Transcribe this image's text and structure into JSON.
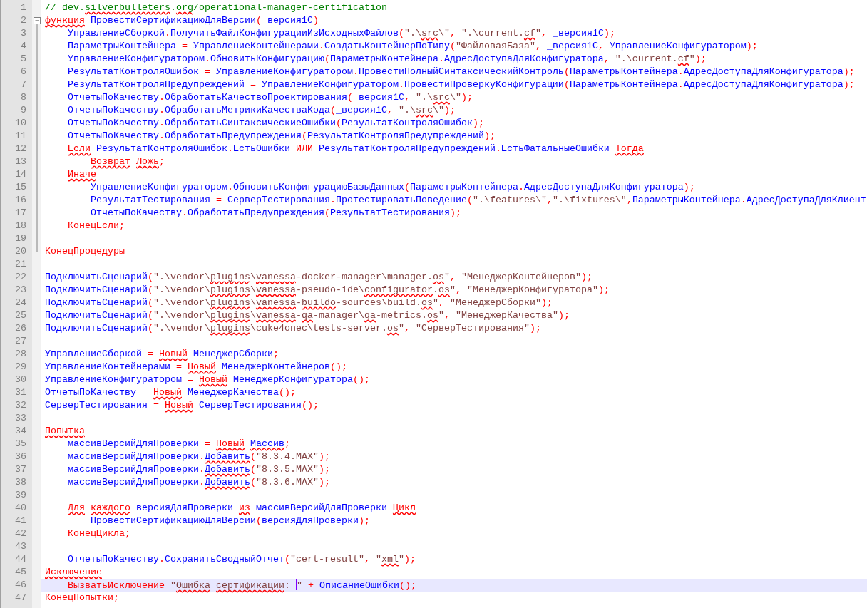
{
  "lines": [
    {
      "number": "1",
      "kind": "plain",
      "segments": [
        {
          "kind": "c",
          "text": "// dev."
        },
        {
          "kind": "c",
          "text": "silverbulleters",
          "spell": true
        },
        {
          "kind": "c",
          "text": "."
        },
        {
          "kind": "c",
          "text": "org",
          "spell": true
        },
        {
          "kind": "c",
          "text": "/operational-manager-certification"
        }
      ]
    },
    {
      "number": "2",
      "kind": "fold-start",
      "segments": [
        {
          "kind": "kw",
          "text": "функция",
          "spell": true
        },
        {
          "kind": "id",
          "text": " ПровестиСертификациюДляВерсии"
        },
        {
          "kind": "op",
          "text": "("
        },
        {
          "kind": "id",
          "text": "_версия1С"
        },
        {
          "kind": "op",
          "text": ")"
        }
      ]
    },
    {
      "number": "3",
      "kind": "fold-body",
      "segments": [
        {
          "kind": "indent"
        },
        {
          "kind": "id",
          "text": "УправлениеСборкой"
        },
        {
          "kind": "op",
          "text": "."
        },
        {
          "kind": "id",
          "text": "ПолучитьФайлКонфигурацииИзИсходныхФайлов"
        },
        {
          "kind": "op",
          "text": "("
        },
        {
          "kind": "s",
          "text": "\".\\"
        },
        {
          "kind": "s",
          "text": "src",
          "spell": true
        },
        {
          "kind": "s",
          "text": "\\\""
        },
        {
          "kind": "op",
          "text": ", "
        },
        {
          "kind": "s",
          "text": "\".\\current."
        },
        {
          "kind": "s",
          "text": "cf",
          "spell": true
        },
        {
          "kind": "s",
          "text": "\""
        },
        {
          "kind": "op",
          "text": ", "
        },
        {
          "kind": "id",
          "text": "_версия1С"
        },
        {
          "kind": "op",
          "text": ");"
        }
      ]
    },
    {
      "number": "4",
      "kind": "fold-body",
      "segments": [
        {
          "kind": "indent"
        },
        {
          "kind": "id",
          "text": "ПараметрыКонтейнера"
        },
        {
          "kind": "op",
          "text": " = "
        },
        {
          "kind": "id",
          "text": "УправлениеКонтейнерами"
        },
        {
          "kind": "op",
          "text": "."
        },
        {
          "kind": "id",
          "text": "СоздатьКонтейнерПоТипу"
        },
        {
          "kind": "op",
          "text": "("
        },
        {
          "kind": "s",
          "text": "\"ФайловаяБаза\""
        },
        {
          "kind": "op",
          "text": ", "
        },
        {
          "kind": "id",
          "text": "_версия1С"
        },
        {
          "kind": "op",
          "text": ", "
        },
        {
          "kind": "id",
          "text": "УправлениеКонфигуратором"
        },
        {
          "kind": "op",
          "text": ");"
        }
      ]
    },
    {
      "number": "5",
      "kind": "fold-body",
      "segments": [
        {
          "kind": "indent"
        },
        {
          "kind": "id",
          "text": "УправлениеКонфигуратором"
        },
        {
          "kind": "op",
          "text": "."
        },
        {
          "kind": "id",
          "text": "ОбновитьКонфигурацию"
        },
        {
          "kind": "op",
          "text": "("
        },
        {
          "kind": "id",
          "text": "ПараметрыКонтейнера"
        },
        {
          "kind": "op",
          "text": "."
        },
        {
          "kind": "id",
          "text": "АдресДоступаДляКонфигуратора"
        },
        {
          "kind": "op",
          "text": ", "
        },
        {
          "kind": "s",
          "text": "\".\\current."
        },
        {
          "kind": "s",
          "text": "cf",
          "spell": true
        },
        {
          "kind": "s",
          "text": "\""
        },
        {
          "kind": "op",
          "text": ");"
        }
      ]
    },
    {
      "number": "6",
      "kind": "fold-body",
      "segments": [
        {
          "kind": "indent"
        },
        {
          "kind": "id",
          "text": "РезультатКонтроляОшибок"
        },
        {
          "kind": "op",
          "text": " = "
        },
        {
          "kind": "id",
          "text": "УправлениеКонфигуратором"
        },
        {
          "kind": "op",
          "text": "."
        },
        {
          "kind": "id",
          "text": "ПровестиПолныйСинтаксическийКонтроль"
        },
        {
          "kind": "op",
          "text": "("
        },
        {
          "kind": "id",
          "text": "ПараметрыКонтейнера"
        },
        {
          "kind": "op",
          "text": "."
        },
        {
          "kind": "id",
          "text": "АдресДоступаДляКонфигуратора"
        },
        {
          "kind": "op",
          "text": ");"
        }
      ]
    },
    {
      "number": "7",
      "kind": "fold-body",
      "segments": [
        {
          "kind": "indent"
        },
        {
          "kind": "id",
          "text": "РезультатКонтроляПредупреждений"
        },
        {
          "kind": "op",
          "text": " = "
        },
        {
          "kind": "id",
          "text": "УправлениеКонфигуратором"
        },
        {
          "kind": "op",
          "text": "."
        },
        {
          "kind": "id",
          "text": "ПровестиПроверкуКонфигурации"
        },
        {
          "kind": "op",
          "text": "("
        },
        {
          "kind": "id",
          "text": "ПараметрыКонтейнера"
        },
        {
          "kind": "op",
          "text": "."
        },
        {
          "kind": "id",
          "text": "АдресДоступаДляКонфигуратора"
        },
        {
          "kind": "op",
          "text": ");"
        }
      ]
    },
    {
      "number": "8",
      "kind": "fold-body",
      "segments": [
        {
          "kind": "indent"
        },
        {
          "kind": "id",
          "text": "ОтчетыПоКачеству"
        },
        {
          "kind": "op",
          "text": "."
        },
        {
          "kind": "id",
          "text": "ОбработатьКачествоПроектирования"
        },
        {
          "kind": "op",
          "text": "("
        },
        {
          "kind": "id",
          "text": "_версия1С"
        },
        {
          "kind": "op",
          "text": ", "
        },
        {
          "kind": "s",
          "text": "\".\\"
        },
        {
          "kind": "s",
          "text": "src",
          "spell": true
        },
        {
          "kind": "s",
          "text": "\\\""
        },
        {
          "kind": "op",
          "text": ");"
        }
      ]
    },
    {
      "number": "9",
      "kind": "fold-body",
      "segments": [
        {
          "kind": "indent"
        },
        {
          "kind": "id",
          "text": "ОтчетыПоКачеству"
        },
        {
          "kind": "op",
          "text": "."
        },
        {
          "kind": "id",
          "text": "ОбработатьМетрикиКачестваКода"
        },
        {
          "kind": "op",
          "text": "("
        },
        {
          "kind": "id",
          "text": "_версия1С"
        },
        {
          "kind": "op",
          "text": ", "
        },
        {
          "kind": "s",
          "text": "\".\\"
        },
        {
          "kind": "s",
          "text": "src",
          "spell": true
        },
        {
          "kind": "s",
          "text": "\\\""
        },
        {
          "kind": "op",
          "text": ");"
        }
      ]
    },
    {
      "number": "10",
      "kind": "fold-body",
      "segments": [
        {
          "kind": "indent"
        },
        {
          "kind": "id",
          "text": "ОтчетыПоКачеству"
        },
        {
          "kind": "op",
          "text": "."
        },
        {
          "kind": "id",
          "text": "ОбработатьСинтаксическиеОшибки"
        },
        {
          "kind": "op",
          "text": "("
        },
        {
          "kind": "id",
          "text": "РезультатКонтроляОшибок"
        },
        {
          "kind": "op",
          "text": ");"
        }
      ]
    },
    {
      "number": "11",
      "kind": "fold-body",
      "segments": [
        {
          "kind": "indent"
        },
        {
          "kind": "id",
          "text": "ОтчетыПоКачеству"
        },
        {
          "kind": "op",
          "text": "."
        },
        {
          "kind": "id",
          "text": "ОбработатьПредупреждения"
        },
        {
          "kind": "op",
          "text": "("
        },
        {
          "kind": "id",
          "text": "РезультатКонтроляПредупреждений"
        },
        {
          "kind": "op",
          "text": ");"
        }
      ]
    },
    {
      "number": "12",
      "kind": "fold-body",
      "segments": [
        {
          "kind": "indent"
        },
        {
          "kind": "kw",
          "text": "Если",
          "spell": true
        },
        {
          "kind": "id",
          "text": " РезультатКонтроляОшибок"
        },
        {
          "kind": "op",
          "text": "."
        },
        {
          "kind": "id",
          "text": "ЕстьОшибки "
        },
        {
          "kind": "kw",
          "text": "ИЛИ"
        },
        {
          "kind": "id",
          "text": " РезультатКонтроляПредупреждений"
        },
        {
          "kind": "op",
          "text": "."
        },
        {
          "kind": "id",
          "text": "ЕстьФатальныеОшибки "
        },
        {
          "kind": "kw",
          "text": "Тогда",
          "spell": true
        }
      ]
    },
    {
      "number": "13",
      "kind": "fold-body",
      "segments": [
        {
          "kind": "indent"
        },
        {
          "kind": "indent"
        },
        {
          "kind": "kw",
          "text": "Возврат",
          "spell": true
        },
        {
          "kind": "gap"
        },
        {
          "kind": "kw",
          "text": "Ложь",
          "spell": true
        },
        {
          "kind": "op",
          "text": ";"
        }
      ]
    },
    {
      "number": "14",
      "kind": "fold-body",
      "segments": [
        {
          "kind": "indent"
        },
        {
          "kind": "kw",
          "text": "Иначе",
          "spell": true
        }
      ]
    },
    {
      "number": "15",
      "kind": "fold-body",
      "segments": [
        {
          "kind": "indent"
        },
        {
          "kind": "indent"
        },
        {
          "kind": "id",
          "text": "УправлениеКонфигуратором"
        },
        {
          "kind": "op",
          "text": "."
        },
        {
          "kind": "id",
          "text": "ОбновитьКонфигурациюБазыДанных"
        },
        {
          "kind": "op",
          "text": "("
        },
        {
          "kind": "id",
          "text": "ПараметрыКонтейнера"
        },
        {
          "kind": "op",
          "text": "."
        },
        {
          "kind": "id",
          "text": "АдресДоступаДляКонфигуратора"
        },
        {
          "kind": "op",
          "text": ");"
        }
      ]
    },
    {
      "number": "16",
      "kind": "fold-body",
      "segments": [
        {
          "kind": "indent"
        },
        {
          "kind": "indent"
        },
        {
          "kind": "id",
          "text": "РезультатТестирования"
        },
        {
          "kind": "op",
          "text": " = "
        },
        {
          "kind": "id",
          "text": "СерверТестирования"
        },
        {
          "kind": "op",
          "text": "."
        },
        {
          "kind": "id",
          "text": "ПротестироватьПоведение"
        },
        {
          "kind": "op",
          "text": "("
        },
        {
          "kind": "s",
          "text": "\".\\features\\\""
        },
        {
          "kind": "op",
          "text": ","
        },
        {
          "kind": "s",
          "text": "\".\\fixtures\\\""
        },
        {
          "kind": "op",
          "text": ","
        },
        {
          "kind": "id",
          "text": "ПараметрыКонтейнера"
        },
        {
          "kind": "op",
          "text": "."
        },
        {
          "kind": "id",
          "text": "АдресДоступаДляКлиент"
        }
      ]
    },
    {
      "number": "17",
      "kind": "fold-body",
      "segments": [
        {
          "kind": "indent"
        },
        {
          "kind": "indent"
        },
        {
          "kind": "id",
          "text": "ОтчетыПоКачеству"
        },
        {
          "kind": "op",
          "text": "."
        },
        {
          "kind": "id",
          "text": "ОбработатьПредупреждения"
        },
        {
          "kind": "op",
          "text": "("
        },
        {
          "kind": "id",
          "text": "РезультатТестирования"
        },
        {
          "kind": "op",
          "text": ");"
        }
      ]
    },
    {
      "number": "18",
      "kind": "fold-body",
      "segments": [
        {
          "kind": "indent"
        },
        {
          "kind": "kw",
          "text": "КонецЕсли"
        },
        {
          "kind": "op",
          "text": ";"
        }
      ]
    },
    {
      "number": "19",
      "kind": "fold-body"
    },
    {
      "number": "20",
      "kind": "fold-end",
      "segments": [
        {
          "kind": "kw",
          "text": "КонецПроцедуры"
        }
      ]
    },
    {
      "number": "21",
      "kind": "plain"
    },
    {
      "number": "22",
      "kind": "plain",
      "segments": [
        {
          "kind": "id",
          "text": "ПодключитьСценарий"
        },
        {
          "kind": "op",
          "text": "("
        },
        {
          "kind": "s",
          "text": "\".\\vendor\\"
        },
        {
          "kind": "s",
          "text": "plugins",
          "spell": true
        },
        {
          "kind": "s",
          "text": "\\"
        },
        {
          "kind": "s",
          "text": "vanessa",
          "spell": true
        },
        {
          "kind": "s",
          "text": "-docker-manager\\manager."
        },
        {
          "kind": "s",
          "text": "os",
          "spell": true
        },
        {
          "kind": "s",
          "text": "\""
        },
        {
          "kind": "op",
          "text": ", "
        },
        {
          "kind": "s",
          "text": "\"МенеджерКонтейнеров\""
        },
        {
          "kind": "op",
          "text": ");"
        }
      ]
    },
    {
      "number": "23",
      "kind": "plain",
      "segments": [
        {
          "kind": "id",
          "text": "ПодключитьСценарий"
        },
        {
          "kind": "op",
          "text": "("
        },
        {
          "kind": "s",
          "text": "\".\\vendor\\"
        },
        {
          "kind": "s",
          "text": "plugins",
          "spell": true
        },
        {
          "kind": "s",
          "text": "\\"
        },
        {
          "kind": "s",
          "text": "vanessa",
          "spell": true
        },
        {
          "kind": "s",
          "text": "-pseudo-ide\\"
        },
        {
          "kind": "s",
          "text": "configurator",
          "spell": true
        },
        {
          "kind": "s",
          "text": "."
        },
        {
          "kind": "s",
          "text": "os",
          "spell": true
        },
        {
          "kind": "s",
          "text": "\""
        },
        {
          "kind": "op",
          "text": ", "
        },
        {
          "kind": "s",
          "text": "\"МенеджерКонфигуратора\""
        },
        {
          "kind": "op",
          "text": ");"
        }
      ]
    },
    {
      "number": "24",
      "kind": "plain",
      "segments": [
        {
          "kind": "id",
          "text": "ПодключитьСценарий"
        },
        {
          "kind": "op",
          "text": "("
        },
        {
          "kind": "s",
          "text": "\".\\vendor\\"
        },
        {
          "kind": "s",
          "text": "plugins",
          "spell": true
        },
        {
          "kind": "s",
          "text": "\\"
        },
        {
          "kind": "s",
          "text": "vanessa",
          "spell": true
        },
        {
          "kind": "s",
          "text": "-"
        },
        {
          "kind": "s",
          "text": "buildo",
          "spell": true
        },
        {
          "kind": "s",
          "text": "-sources\\build."
        },
        {
          "kind": "s",
          "text": "os",
          "spell": true
        },
        {
          "kind": "s",
          "text": "\""
        },
        {
          "kind": "op",
          "text": ", "
        },
        {
          "kind": "s",
          "text": "\"МенеджерСборки\""
        },
        {
          "kind": "op",
          "text": ");"
        }
      ]
    },
    {
      "number": "25",
      "kind": "plain",
      "segments": [
        {
          "kind": "id",
          "text": "ПодключитьСценарий"
        },
        {
          "kind": "op",
          "text": "("
        },
        {
          "kind": "s",
          "text": "\".\\vendor\\"
        },
        {
          "kind": "s",
          "text": "plugins",
          "spell": true
        },
        {
          "kind": "s",
          "text": "\\"
        },
        {
          "kind": "s",
          "text": "vanessa",
          "spell": true
        },
        {
          "kind": "s",
          "text": "-"
        },
        {
          "kind": "s",
          "text": "qa",
          "spell": true
        },
        {
          "kind": "s",
          "text": "-manager\\"
        },
        {
          "kind": "s",
          "text": "qa",
          "spell": true
        },
        {
          "kind": "s",
          "text": "-metrics."
        },
        {
          "kind": "s",
          "text": "os",
          "spell": true
        },
        {
          "kind": "s",
          "text": "\""
        },
        {
          "kind": "op",
          "text": ", "
        },
        {
          "kind": "s",
          "text": "\"МенеджерКачества\""
        },
        {
          "kind": "op",
          "text": ");"
        }
      ]
    },
    {
      "number": "26",
      "kind": "plain",
      "segments": [
        {
          "kind": "id",
          "text": "ПодключитьСценарий"
        },
        {
          "kind": "op",
          "text": "("
        },
        {
          "kind": "s",
          "text": "\".\\vendor\\"
        },
        {
          "kind": "s",
          "text": "plugins",
          "spell": true
        },
        {
          "kind": "s",
          "text": "\\cuke4onec\\tests-server."
        },
        {
          "kind": "s",
          "text": "os",
          "spell": true
        },
        {
          "kind": "s",
          "text": "\""
        },
        {
          "kind": "op",
          "text": ", "
        },
        {
          "kind": "s",
          "text": "\"СерверТестирования\""
        },
        {
          "kind": "op",
          "text": ");"
        }
      ]
    },
    {
      "number": "27",
      "kind": "plain"
    },
    {
      "number": "28",
      "kind": "plain",
      "segments": [
        {
          "kind": "id",
          "text": "УправлениеСборкой"
        },
        {
          "kind": "op",
          "text": " = "
        },
        {
          "kind": "kw",
          "text": "Новый",
          "spell": true
        },
        {
          "kind": "id",
          "text": " МенеджерСборки"
        },
        {
          "kind": "op",
          "text": ";"
        }
      ]
    },
    {
      "number": "29",
      "kind": "plain",
      "segments": [
        {
          "kind": "id",
          "text": "УправлениеКонтейнерами"
        },
        {
          "kind": "op",
          "text": " = "
        },
        {
          "kind": "kw",
          "text": "Новый",
          "spell": true
        },
        {
          "kind": "id",
          "text": " МенеджерКонтейнеров"
        },
        {
          "kind": "op",
          "text": "();"
        }
      ]
    },
    {
      "number": "30",
      "kind": "plain",
      "segments": [
        {
          "kind": "id",
          "text": "УправлениеКонфигуратором"
        },
        {
          "kind": "op",
          "text": " = "
        },
        {
          "kind": "kw",
          "text": "Новый",
          "spell": true
        },
        {
          "kind": "id",
          "text": " МенеджерКонфигуратора"
        },
        {
          "kind": "op",
          "text": "();"
        }
      ]
    },
    {
      "number": "31",
      "kind": "plain",
      "segments": [
        {
          "kind": "id",
          "text": "ОтчетыПоКачеству"
        },
        {
          "kind": "op",
          "text": " = "
        },
        {
          "kind": "kw",
          "text": "Новый",
          "spell": true
        },
        {
          "kind": "id",
          "text": " МенеджерКачества"
        },
        {
          "kind": "op",
          "text": "();"
        }
      ]
    },
    {
      "number": "32",
      "kind": "plain",
      "segments": [
        {
          "kind": "id",
          "text": "СерверТестирования"
        },
        {
          "kind": "op",
          "text": " = "
        },
        {
          "kind": "kw",
          "text": "Новый",
          "spell": true
        },
        {
          "kind": "id",
          "text": " СерверТестирования"
        },
        {
          "kind": "op",
          "text": "();"
        }
      ]
    },
    {
      "number": "33",
      "kind": "plain"
    },
    {
      "number": "34",
      "kind": "plain",
      "segments": [
        {
          "kind": "kw",
          "text": "Попытка",
          "spell": true
        }
      ]
    },
    {
      "number": "35",
      "kind": "plain",
      "segments": [
        {
          "kind": "indent"
        },
        {
          "kind": "id",
          "text": "массивВерсийДляПроверки"
        },
        {
          "kind": "op",
          "text": " = "
        },
        {
          "kind": "kw",
          "text": "Новый",
          "spell": true
        },
        {
          "kind": "gap"
        },
        {
          "kind": "id",
          "text": "Массив",
          "spell": true
        },
        {
          "kind": "op",
          "text": ";"
        }
      ]
    },
    {
      "number": "36",
      "kind": "plain",
      "segments": [
        {
          "kind": "indent"
        },
        {
          "kind": "id",
          "text": "массивВерсийДляПроверки"
        },
        {
          "kind": "op",
          "text": "."
        },
        {
          "kind": "id",
          "text": "Добавить",
          "spell": true
        },
        {
          "kind": "op",
          "text": "("
        },
        {
          "kind": "s",
          "text": "\"8.3.4.MAX\""
        },
        {
          "kind": "op",
          "text": ");"
        }
      ]
    },
    {
      "number": "37",
      "kind": "plain",
      "segments": [
        {
          "kind": "indent"
        },
        {
          "kind": "id",
          "text": "массивВерсийДляПроверки"
        },
        {
          "kind": "op",
          "text": "."
        },
        {
          "kind": "id",
          "text": "Добавить",
          "spell": true
        },
        {
          "kind": "op",
          "text": "("
        },
        {
          "kind": "s",
          "text": "\"8.3.5.MAX\""
        },
        {
          "kind": "op",
          "text": ");"
        }
      ]
    },
    {
      "number": "38",
      "kind": "plain",
      "segments": [
        {
          "kind": "indent"
        },
        {
          "kind": "id",
          "text": "массивВерсийДляПроверки"
        },
        {
          "kind": "op",
          "text": "."
        },
        {
          "kind": "id",
          "text": "Добавить",
          "spell": true
        },
        {
          "kind": "op",
          "text": "("
        },
        {
          "kind": "s",
          "text": "\"8.3.6.MAX\""
        },
        {
          "kind": "op",
          "text": ");"
        }
      ]
    },
    {
      "number": "39",
      "kind": "plain"
    },
    {
      "number": "40",
      "kind": "plain",
      "segments": [
        {
          "kind": "indent"
        },
        {
          "kind": "kw",
          "text": "Для",
          "spell": true
        },
        {
          "kind": "gap"
        },
        {
          "kind": "kw",
          "text": "каждого",
          "spell": true
        },
        {
          "kind": "id",
          "text": " версияДляПроверки "
        },
        {
          "kind": "kw",
          "text": "из",
          "spell": true
        },
        {
          "kind": "id",
          "text": " массивВерсийДляПроверки "
        },
        {
          "kind": "kw",
          "text": "Цикл",
          "spell": true
        }
      ]
    },
    {
      "number": "41",
      "kind": "plain",
      "segments": [
        {
          "kind": "indent"
        },
        {
          "kind": "indent"
        },
        {
          "kind": "id",
          "text": "ПровестиСертификациюДляВерсии"
        },
        {
          "kind": "op",
          "text": "("
        },
        {
          "kind": "id",
          "text": "версияДляПроверки"
        },
        {
          "kind": "op",
          "text": ");"
        }
      ]
    },
    {
      "number": "42",
      "kind": "plain",
      "segments": [
        {
          "kind": "indent"
        },
        {
          "kind": "kw",
          "text": "КонецЦикла"
        },
        {
          "kind": "op",
          "text": ";"
        }
      ]
    },
    {
      "number": "43",
      "kind": "plain"
    },
    {
      "number": "44",
      "kind": "plain",
      "segments": [
        {
          "kind": "indent"
        },
        {
          "kind": "id",
          "text": "ОтчетыПоКачеству"
        },
        {
          "kind": "op",
          "text": "."
        },
        {
          "kind": "id",
          "text": "СохранитьСводныйОтчет"
        },
        {
          "kind": "op",
          "text": "("
        },
        {
          "kind": "s",
          "text": "\"cert-result\""
        },
        {
          "kind": "op",
          "text": ", "
        },
        {
          "kind": "s",
          "text": "\""
        },
        {
          "kind": "s",
          "text": "xml",
          "spell": true
        },
        {
          "kind": "s",
          "text": "\""
        },
        {
          "kind": "op",
          "text": ");"
        }
      ]
    },
    {
      "number": "45",
      "kind": "plain",
      "segments": [
        {
          "kind": "kw",
          "text": "Исключение",
          "spell": true
        }
      ]
    },
    {
      "number": "46",
      "kind": "plain",
      "current": true,
      "segments": [
        {
          "kind": "indent"
        },
        {
          "kind": "kw",
          "text": "ВызватьИсключение"
        },
        {
          "kind": "s",
          "text": " \""
        },
        {
          "kind": "s",
          "text": "Ошибка",
          "spell": true
        },
        {
          "kind": "gap"
        },
        {
          "kind": "s",
          "text": "сертификации",
          "spell": true
        },
        {
          "kind": "s",
          "text": ": "
        },
        {
          "kind": "caret"
        },
        {
          "kind": "s",
          "text": "\""
        },
        {
          "kind": "op",
          "text": " + "
        },
        {
          "kind": "id",
          "text": "ОписаниеОшибки"
        },
        {
          "kind": "op",
          "text": "();"
        }
      ]
    },
    {
      "number": "47",
      "kind": "plain",
      "segments": [
        {
          "kind": "kw",
          "text": "КонецПопытки"
        },
        {
          "kind": "op",
          "text": ";"
        }
      ]
    }
  ]
}
